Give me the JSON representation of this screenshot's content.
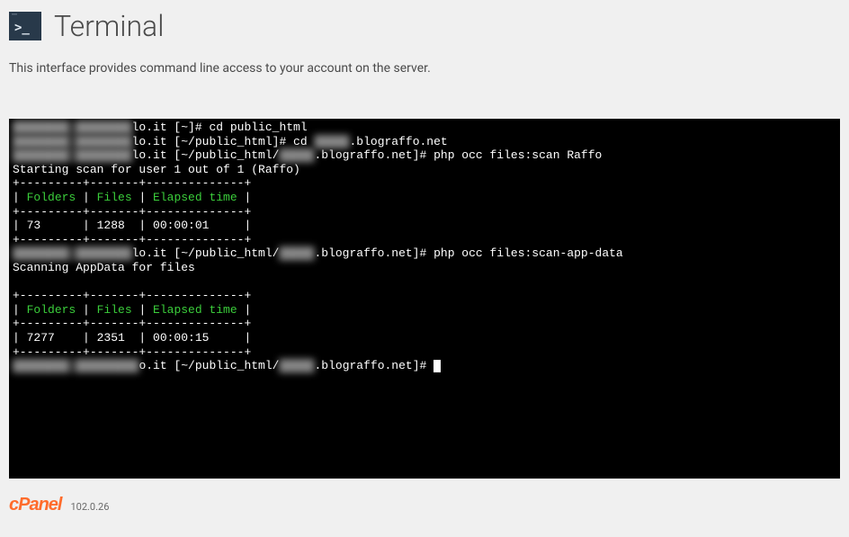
{
  "header": {
    "icon_glyph": ">_",
    "title": "Terminal"
  },
  "description": "This interface provides command line access to your account on the server.",
  "terminal": {
    "lines": [
      {
        "segments": [
          {
            "t": "████████ ████████",
            "cls": "blur"
          },
          {
            "t": "lo.it [~]# cd public_html"
          }
        ]
      },
      {
        "segments": [
          {
            "t": "████████ ████████",
            "cls": "blur"
          },
          {
            "t": "lo.it [~/public_html]# cd "
          },
          {
            "t": "█████",
            "cls": "blur"
          },
          {
            "t": ".blograffo.net"
          }
        ]
      },
      {
        "segments": [
          {
            "t": "████████ ████████",
            "cls": "blur"
          },
          {
            "t": "lo.it [~/public_html/"
          },
          {
            "t": "█████",
            "cls": "blur"
          },
          {
            "t": ".blograffo.net]# php occ files:scan Raffo"
          }
        ]
      },
      {
        "segments": [
          {
            "t": "Starting scan for user 1 out of 1 (Raffo)"
          }
        ]
      },
      {
        "segments": [
          {
            "t": "+---------+-------+--------------+"
          }
        ]
      },
      {
        "segments": [
          {
            "t": "| "
          },
          {
            "t": "Folders",
            "cls": "green"
          },
          {
            "t": " | "
          },
          {
            "t": "Files",
            "cls": "green"
          },
          {
            "t": " | "
          },
          {
            "t": "Elapsed time",
            "cls": "green"
          },
          {
            "t": " |"
          }
        ]
      },
      {
        "segments": [
          {
            "t": "+---------+-------+--------------+"
          }
        ]
      },
      {
        "segments": [
          {
            "t": "| 73      | 1288  | 00:00:01     |"
          }
        ]
      },
      {
        "segments": [
          {
            "t": "+---------+-------+--------------+"
          }
        ]
      },
      {
        "segments": [
          {
            "t": "████████ ████████",
            "cls": "blur"
          },
          {
            "t": "lo.it [~/public_html/"
          },
          {
            "t": "█████",
            "cls": "blur"
          },
          {
            "t": ".blograffo.net]# php occ files:scan-app-data"
          }
        ]
      },
      {
        "segments": [
          {
            "t": "Scanning AppData for files"
          }
        ]
      },
      {
        "segments": [
          {
            "t": ""
          }
        ]
      },
      {
        "segments": [
          {
            "t": "+---------+-------+--------------+"
          }
        ]
      },
      {
        "segments": [
          {
            "t": "| "
          },
          {
            "t": "Folders",
            "cls": "green"
          },
          {
            "t": " | "
          },
          {
            "t": "Files",
            "cls": "green"
          },
          {
            "t": " | "
          },
          {
            "t": "Elapsed time",
            "cls": "green"
          },
          {
            "t": " |"
          }
        ]
      },
      {
        "segments": [
          {
            "t": "+---------+-------+--------------+"
          }
        ]
      },
      {
        "segments": [
          {
            "t": "| 7277    | 2351  | 00:00:15     |"
          }
        ]
      },
      {
        "segments": [
          {
            "t": "+---------+-------+--------------+"
          }
        ]
      },
      {
        "segments": [
          {
            "t": "████████ █████████",
            "cls": "blur"
          },
          {
            "t": "o.it [~/public_html/"
          },
          {
            "t": "█████",
            "cls": "blur"
          },
          {
            "t": ".blograffo.net]# "
          },
          {
            "cursor": true
          }
        ]
      }
    ]
  },
  "footer": {
    "logo_text": "cPanel",
    "version": "102.0.26"
  }
}
